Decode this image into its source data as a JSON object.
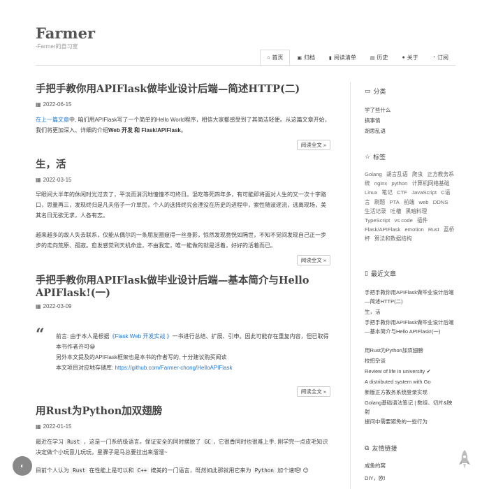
{
  "site": {
    "title": "Farmer",
    "subtitle": "-Farmer的自习室"
  },
  "nav": [
    {
      "icon": "home-icon",
      "glyph": "⌂",
      "label": "首页",
      "active": true
    },
    {
      "icon": "archive-icon",
      "glyph": "▣",
      "label": "归档",
      "active": false
    },
    {
      "icon": "bookmark-icon",
      "glyph": "▮",
      "label": "阅读清单",
      "active": false
    },
    {
      "icon": "book-icon",
      "glyph": "▤",
      "label": "历史",
      "active": false
    },
    {
      "icon": "user-icon",
      "glyph": "●",
      "label": "关于",
      "active": false
    },
    {
      "icon": "rss-icon",
      "glyph": "◔",
      "label": "订阅",
      "active": false
    }
  ],
  "posts": [
    {
      "title": "手把手教你用APIFlask做毕业设计后端—简述HTTP(二)",
      "date": "2022-06-15",
      "p1_link": "在上一篇文章",
      "p1_a": "中, 咱们用APIFlask写了一个简单的Hello World程序，相信大家都感受到了其简洁轻便。从这篇文章开始，我们将更加深入、详细的介绍",
      "p1_b": "Web 开发 和 Flask/APIFlask",
      "p1_end": "。",
      "more": "阅读全文 »"
    },
    {
      "title": "生，活",
      "date": "2022-03-15",
      "p1": "早眼间大半年的休闲时光过去了，平淡而消沉地憧憧不可终日。混吃等死四年多，有可能即将面对人生的又一次十字路口，思量再三，发现终归是凡夫俗子一介草民，个人的选择终究会湮没在历史的进程中，索性随波逐流，逃离现场，美其名日无欲无求，人各有志。",
      "p2": "越来越多的故人失去联系，仅能从偶尔的一条朋友圈窥得一丝身影，惊然发现竟恍如隔世，不知不觉间发现自己正一步步的走向荒原、孤寂。愈发感觉到天机命途，不由我定，唯一能做的就是活着，好好的活着而已。",
      "more": "阅读全文 »"
    },
    {
      "title": "手把手教你用APIFlask做毕业设计后端—基本简介与Hello APIFlask!(一)",
      "date": "2022-03-09",
      "q1a": "前言: 由于本人是根据",
      "q1link": "《Flask Web 开发实战 》",
      "q1b": "一书进行总结、扩展、引申。因此可能存在重复内容，但已取得本书作者许可😀",
      "q2": "另外本文提及的APIFlask框架也是本书的作者写的, 十分建议购买阅读",
      "q3a": "本文项目对应地存储库: ",
      "q3link": "https://github.com/Farmer-chong/HelloAPIFlask",
      "more": "阅读全文 »"
    },
    {
      "title": "用Rust为Python加双翅膀",
      "date": "2022-01-15",
      "p1a": "最近在学习 ",
      "p1c1": "Rust",
      "p1b": " ，这是一门系统级语言。保证安全的同时摆脱了 ",
      "p1c2": "GC",
      "p1c": "，它很香同时也很难上手, 刚学完一点皮毛知识决定做个小玩意儿玩玩，星骤子是马总要拉出来溜溜~",
      "p2a": "目前个人认为 ",
      "p2c1": "Rust",
      "p2b": " 在性能上是可以和 ",
      "p2c2": "C++",
      "p2c": " 媲美的一门语言，既然如此那就用它来为 ",
      "p2c3": "Python",
      "p2d": " 加个速吧! 😊"
    }
  ],
  "sidebar": {
    "categories": {
      "heading": "分类",
      "icon": "folder-icon",
      "items": [
        "学了些什么",
        "搞事情",
        "胡思乱语"
      ]
    },
    "tags": {
      "heading": "标签",
      "icon": "star-icon",
      "items": [
        "Golang",
        "胡言乱语",
        "爬虫",
        "正方教务系统",
        "nginx",
        "python",
        "计算机网络基础",
        "Linux",
        "笔记",
        "CTF",
        "JavaScript",
        "C语言",
        "刷题",
        "PTA",
        "前端",
        "web",
        "DDNS",
        "生活记录",
        "吐槽",
        "黑暗料理",
        "TypeScript",
        "vs code",
        "插件",
        "Flask/APIFlask",
        "emotion",
        "Rust",
        "蓝桥杯",
        "算法和数据结构"
      ]
    },
    "recent": {
      "heading": "最近文章",
      "icon": "file-icon",
      "items": [
        "手把手教你用APIFlask做毕业设计后端—简述HTTP(二)",
        "生，活",
        "手把手教你用APIFlask做毕业设计后端—基本简介与Hello APIFlask!(一)",
        "用Rust为Python加双翅膀",
        "校招杂谈",
        "Review of life in university ✔",
        "A distributed system with Go",
        "新版正方教务系统登录实现",
        "Golang基础语法笔记 | 数组、切片&映射",
        "提问中需要避免的一些行为"
      ]
    },
    "links": {
      "heading": "友情链接",
      "icon": "link-icon",
      "items": [
        "咸鱼的窝",
        "DIY，欧!"
      ]
    }
  },
  "theme_toggle": "◐"
}
